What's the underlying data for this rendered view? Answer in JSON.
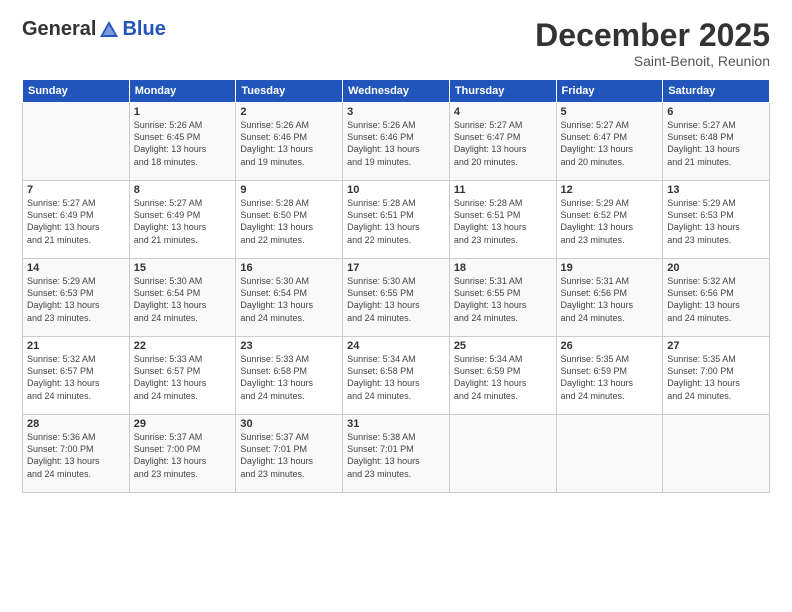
{
  "header": {
    "logo_general": "General",
    "logo_blue": "Blue",
    "title": "December 2025",
    "subtitle": "Saint-Benoit, Reunion"
  },
  "columns": [
    "Sunday",
    "Monday",
    "Tuesday",
    "Wednesday",
    "Thursday",
    "Friday",
    "Saturday"
  ],
  "weeks": [
    [
      {
        "day": "",
        "info": ""
      },
      {
        "day": "1",
        "info": "Sunrise: 5:26 AM\nSunset: 6:45 PM\nDaylight: 13 hours\nand 18 minutes."
      },
      {
        "day": "2",
        "info": "Sunrise: 5:26 AM\nSunset: 6:46 PM\nDaylight: 13 hours\nand 19 minutes."
      },
      {
        "day": "3",
        "info": "Sunrise: 5:26 AM\nSunset: 6:46 PM\nDaylight: 13 hours\nand 19 minutes."
      },
      {
        "day": "4",
        "info": "Sunrise: 5:27 AM\nSunset: 6:47 PM\nDaylight: 13 hours\nand 20 minutes."
      },
      {
        "day": "5",
        "info": "Sunrise: 5:27 AM\nSunset: 6:47 PM\nDaylight: 13 hours\nand 20 minutes."
      },
      {
        "day": "6",
        "info": "Sunrise: 5:27 AM\nSunset: 6:48 PM\nDaylight: 13 hours\nand 21 minutes."
      }
    ],
    [
      {
        "day": "7",
        "info": "Sunrise: 5:27 AM\nSunset: 6:49 PM\nDaylight: 13 hours\nand 21 minutes."
      },
      {
        "day": "8",
        "info": "Sunrise: 5:27 AM\nSunset: 6:49 PM\nDaylight: 13 hours\nand 21 minutes."
      },
      {
        "day": "9",
        "info": "Sunrise: 5:28 AM\nSunset: 6:50 PM\nDaylight: 13 hours\nand 22 minutes."
      },
      {
        "day": "10",
        "info": "Sunrise: 5:28 AM\nSunset: 6:51 PM\nDaylight: 13 hours\nand 22 minutes."
      },
      {
        "day": "11",
        "info": "Sunrise: 5:28 AM\nSunset: 6:51 PM\nDaylight: 13 hours\nand 23 minutes."
      },
      {
        "day": "12",
        "info": "Sunrise: 5:29 AM\nSunset: 6:52 PM\nDaylight: 13 hours\nand 23 minutes."
      },
      {
        "day": "13",
        "info": "Sunrise: 5:29 AM\nSunset: 6:53 PM\nDaylight: 13 hours\nand 23 minutes."
      }
    ],
    [
      {
        "day": "14",
        "info": "Sunrise: 5:29 AM\nSunset: 6:53 PM\nDaylight: 13 hours\nand 23 minutes."
      },
      {
        "day": "15",
        "info": "Sunrise: 5:30 AM\nSunset: 6:54 PM\nDaylight: 13 hours\nand 24 minutes."
      },
      {
        "day": "16",
        "info": "Sunrise: 5:30 AM\nSunset: 6:54 PM\nDaylight: 13 hours\nand 24 minutes."
      },
      {
        "day": "17",
        "info": "Sunrise: 5:30 AM\nSunset: 6:55 PM\nDaylight: 13 hours\nand 24 minutes."
      },
      {
        "day": "18",
        "info": "Sunrise: 5:31 AM\nSunset: 6:55 PM\nDaylight: 13 hours\nand 24 minutes."
      },
      {
        "day": "19",
        "info": "Sunrise: 5:31 AM\nSunset: 6:56 PM\nDaylight: 13 hours\nand 24 minutes."
      },
      {
        "day": "20",
        "info": "Sunrise: 5:32 AM\nSunset: 6:56 PM\nDaylight: 13 hours\nand 24 minutes."
      }
    ],
    [
      {
        "day": "21",
        "info": "Sunrise: 5:32 AM\nSunset: 6:57 PM\nDaylight: 13 hours\nand 24 minutes."
      },
      {
        "day": "22",
        "info": "Sunrise: 5:33 AM\nSunset: 6:57 PM\nDaylight: 13 hours\nand 24 minutes."
      },
      {
        "day": "23",
        "info": "Sunrise: 5:33 AM\nSunset: 6:58 PM\nDaylight: 13 hours\nand 24 minutes."
      },
      {
        "day": "24",
        "info": "Sunrise: 5:34 AM\nSunset: 6:58 PM\nDaylight: 13 hours\nand 24 minutes."
      },
      {
        "day": "25",
        "info": "Sunrise: 5:34 AM\nSunset: 6:59 PM\nDaylight: 13 hours\nand 24 minutes."
      },
      {
        "day": "26",
        "info": "Sunrise: 5:35 AM\nSunset: 6:59 PM\nDaylight: 13 hours\nand 24 minutes."
      },
      {
        "day": "27",
        "info": "Sunrise: 5:35 AM\nSunset: 7:00 PM\nDaylight: 13 hours\nand 24 minutes."
      }
    ],
    [
      {
        "day": "28",
        "info": "Sunrise: 5:36 AM\nSunset: 7:00 PM\nDaylight: 13 hours\nand 24 minutes."
      },
      {
        "day": "29",
        "info": "Sunrise: 5:37 AM\nSunset: 7:00 PM\nDaylight: 13 hours\nand 23 minutes."
      },
      {
        "day": "30",
        "info": "Sunrise: 5:37 AM\nSunset: 7:01 PM\nDaylight: 13 hours\nand 23 minutes."
      },
      {
        "day": "31",
        "info": "Sunrise: 5:38 AM\nSunset: 7:01 PM\nDaylight: 13 hours\nand 23 minutes."
      },
      {
        "day": "",
        "info": ""
      },
      {
        "day": "",
        "info": ""
      },
      {
        "day": "",
        "info": ""
      }
    ]
  ]
}
